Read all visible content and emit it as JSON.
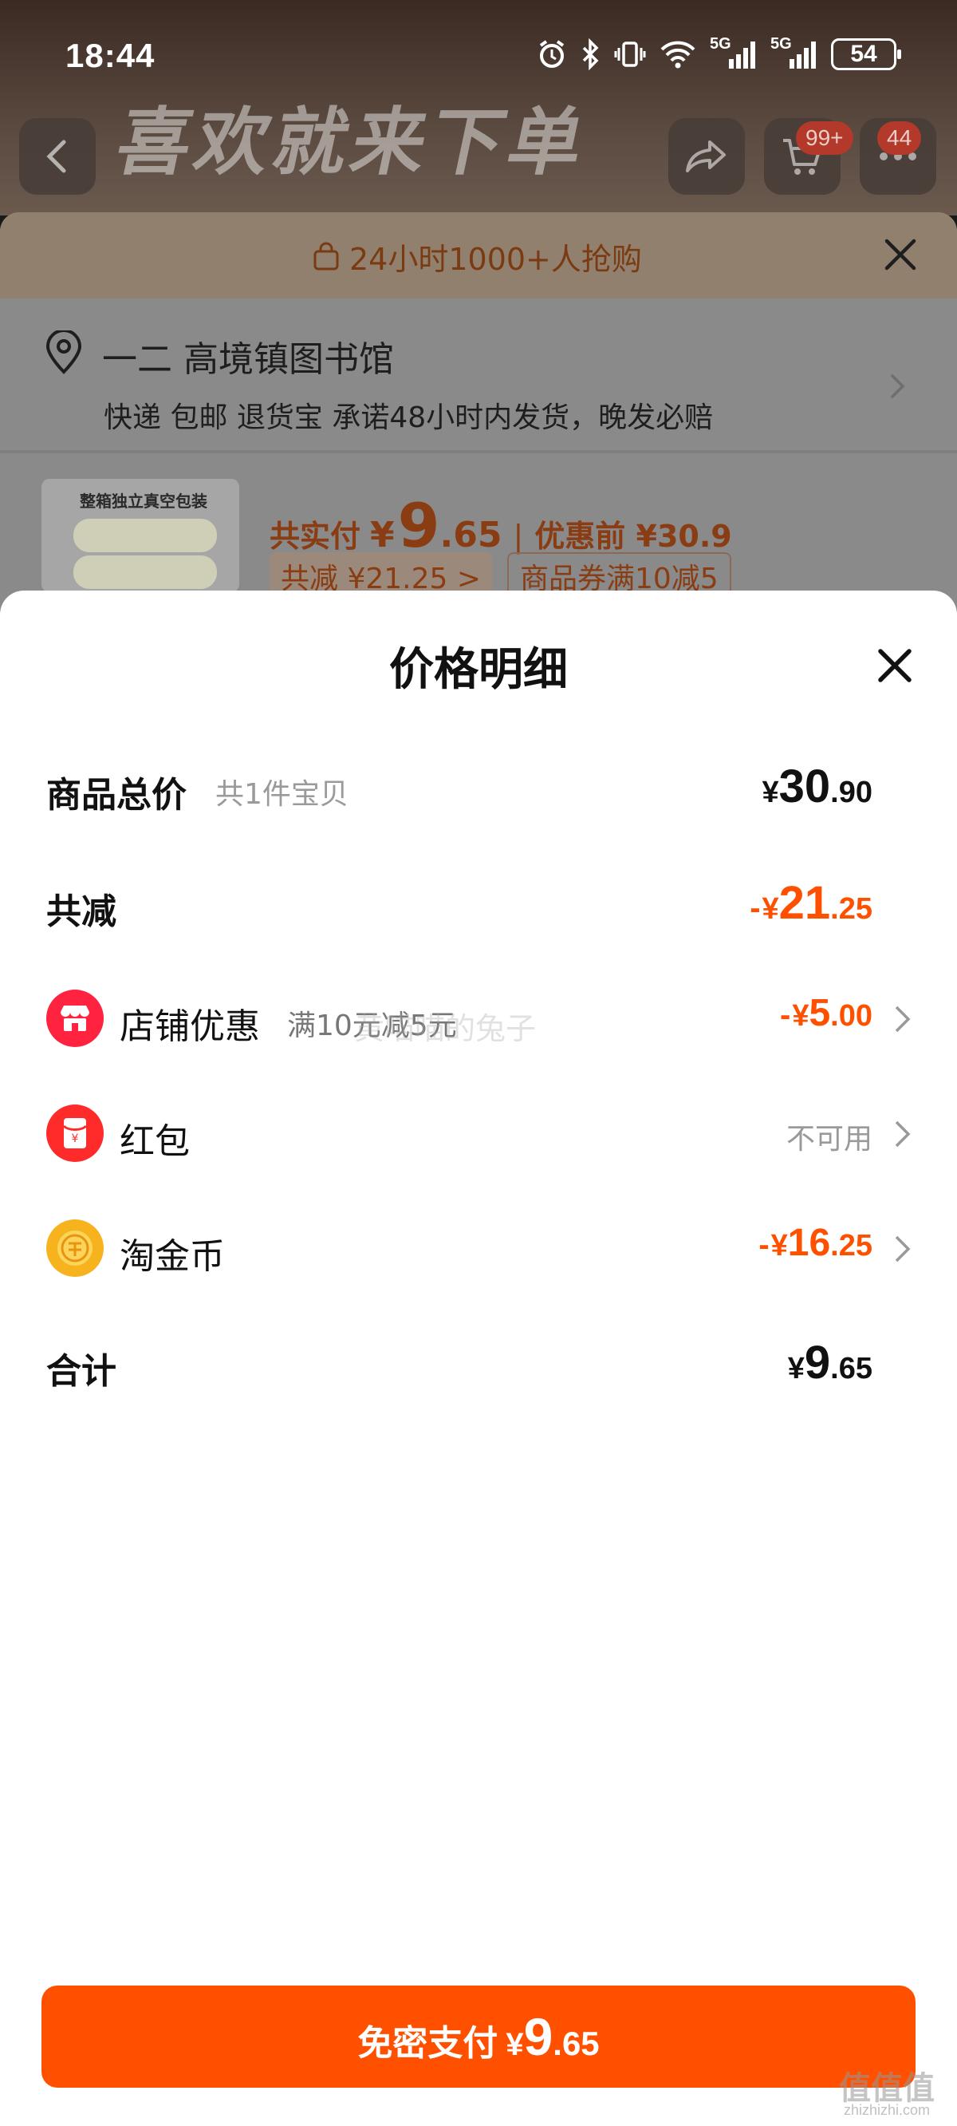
{
  "status_bar": {
    "time": "18:44",
    "battery": "54",
    "network_label_1": "5G",
    "network_label_2": "5G"
  },
  "background": {
    "banner_text": "喜欢就来下单",
    "cart_badge": "99+",
    "more_badge": "44",
    "rush_text": "24小时1000+人抢购",
    "address_name": "一二 高境镇图书馆",
    "address_tags": "快递 包邮 退货宝 承诺48小时内发货，晚发必赔",
    "product_image_label": "整箱独立真空包装",
    "paid_label": "共实付",
    "paid_yen": "¥",
    "paid_int": "9",
    "paid_dec": ".65",
    "paid_sep": "|",
    "paid_before": "优惠前 ¥30.9",
    "chip_total_reduce": "共减 ¥21.25 >",
    "chip_coupon": "商品券满10减5"
  },
  "sheet": {
    "title": "价格明细",
    "rows": {
      "subtotal": {
        "label": "商品总价",
        "sub": "共1件宝贝",
        "yen": "¥",
        "int": "30",
        "dec": ".90"
      },
      "total_reduce": {
        "label": "共减",
        "minus": "-",
        "yen": "¥",
        "int": "21",
        "dec": ".25"
      },
      "shop_discount": {
        "label": "店铺优惠",
        "sub": "满10元减5元",
        "minus": "-",
        "yen": "¥",
        "int": "5",
        "dec": ".00"
      },
      "red_packet": {
        "label": "红包",
        "status": "不可用"
      },
      "taojin_coin": {
        "label": "淘金币",
        "minus": "-",
        "yen": "¥",
        "int": "16",
        "dec": ".25"
      },
      "total": {
        "label": "合计",
        "yen": "¥",
        "int": "9",
        "dec": ".65"
      }
    },
    "watermark": "黄喵喵的兔子"
  },
  "pay_button": {
    "label": "免密支付",
    "yen": "¥",
    "int": "9",
    "dec": ".65"
  },
  "site_mark": {
    "logo": "值值值",
    "url": "zhizhizhi.com"
  },
  "colors": {
    "accent": "#ff5000",
    "dark_text": "#111111",
    "muted_text": "#999999"
  }
}
